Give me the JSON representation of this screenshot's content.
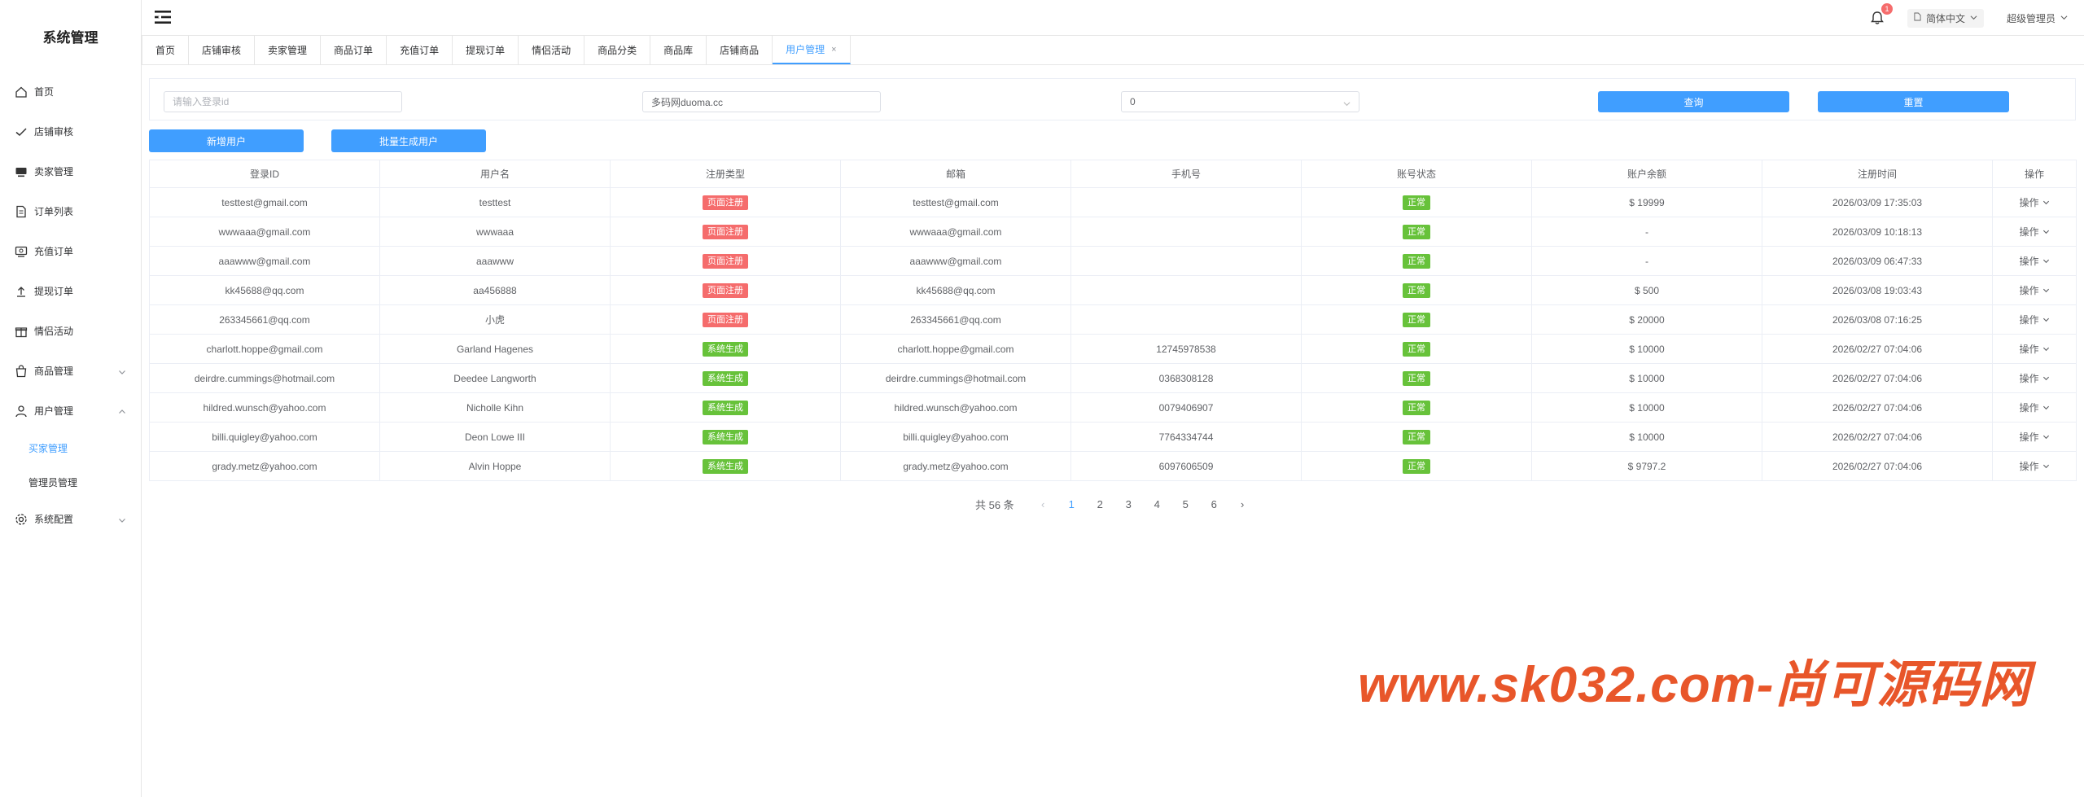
{
  "sidebar": {
    "title": "系统管理",
    "items": [
      {
        "label": "首页",
        "icon": "home-icon"
      },
      {
        "label": "店铺审核",
        "icon": "check-icon"
      },
      {
        "label": "卖家管理",
        "icon": "monitor-icon"
      },
      {
        "label": "订单列表",
        "icon": "document-icon"
      },
      {
        "label": "充值订单",
        "icon": "recharge-icon"
      },
      {
        "label": "提现订单",
        "icon": "upload-icon"
      },
      {
        "label": "情侣活动",
        "icon": "gift-icon"
      },
      {
        "label": "商品管理",
        "icon": "bag-icon"
      },
      {
        "label": "用户管理",
        "icon": "user-icon"
      },
      {
        "label": "系统配置",
        "icon": "gear-icon"
      }
    ],
    "submenu": [
      {
        "label": "买家管理"
      },
      {
        "label": "管理员管理"
      }
    ]
  },
  "header": {
    "notification_count": "1",
    "language": "简体中文",
    "user": "超级管理员"
  },
  "tabs": [
    {
      "label": "首页"
    },
    {
      "label": "店铺审核"
    },
    {
      "label": "卖家管理"
    },
    {
      "label": "商品订单"
    },
    {
      "label": "充值订单"
    },
    {
      "label": "提现订单"
    },
    {
      "label": "情侣活动"
    },
    {
      "label": "商品分类"
    },
    {
      "label": "商品库"
    },
    {
      "label": "店铺商品"
    },
    {
      "label": "用户管理",
      "close": "×"
    }
  ],
  "search": {
    "login_id_placeholder": "请输入登录id",
    "domain_value": "多码网duoma.cc",
    "select_value": "0",
    "query_label": "查询",
    "reset_label": "重置"
  },
  "actions": {
    "add_user_label": "新增用户",
    "batch_generate_label": "批量生成用户"
  },
  "table": {
    "headers": [
      "登录ID",
      "用户名",
      "注册类型",
      "邮箱",
      "手机号",
      "账号状态",
      "账户余额",
      "注册时间",
      "操作"
    ],
    "rows": [
      {
        "login_id": "testtest@gmail.com",
        "username": "testtest",
        "reg_type": "页面注册",
        "email": "testtest@gmail.com",
        "phone": "",
        "status": "正常",
        "balance": "$ 19999",
        "reg_time": "2026/03/09 17:35:03",
        "op": "操作"
      },
      {
        "login_id": "wwwaaa@gmail.com",
        "username": "wwwaaa",
        "reg_type": "页面注册",
        "email": "wwwaaa@gmail.com",
        "phone": "",
        "status": "正常",
        "balance": "-",
        "reg_time": "2026/03/09 10:18:13",
        "op": "操作"
      },
      {
        "login_id": "aaawww@gmail.com",
        "username": "aaawww",
        "reg_type": "页面注册",
        "email": "aaawww@gmail.com",
        "phone": "",
        "status": "正常",
        "balance": "-",
        "reg_time": "2026/03/09 06:47:33",
        "op": "操作"
      },
      {
        "login_id": "kk45688@qq.com",
        "username": "aa456888",
        "reg_type": "页面注册",
        "email": "kk45688@qq.com",
        "phone": "",
        "status": "正常",
        "balance": "$ 500",
        "reg_time": "2026/03/08 19:03:43",
        "op": "操作"
      },
      {
        "login_id": "263345661@qq.com",
        "username": "小虎",
        "reg_type": "页面注册",
        "email": "263345661@qq.com",
        "phone": "",
        "status": "正常",
        "balance": "$ 20000",
        "reg_time": "2026/03/08 07:16:25",
        "op": "操作"
      },
      {
        "login_id": "charlott.hoppe@gmail.com",
        "username": "Garland Hagenes",
        "reg_type": "系统生成",
        "email": "charlott.hoppe@gmail.com",
        "phone": "12745978538",
        "status": "正常",
        "balance": "$ 10000",
        "reg_time": "2026/02/27 07:04:06",
        "op": "操作"
      },
      {
        "login_id": "deirdre.cummings@hotmail.com",
        "username": "Deedee Langworth",
        "reg_type": "系统生成",
        "email": "deirdre.cummings@hotmail.com",
        "phone": "0368308128",
        "status": "正常",
        "balance": "$ 10000",
        "reg_time": "2026/02/27 07:04:06",
        "op": "操作"
      },
      {
        "login_id": "hildred.wunsch@yahoo.com",
        "username": "Nicholle Kihn",
        "reg_type": "系统生成",
        "email": "hildred.wunsch@yahoo.com",
        "phone": "0079406907",
        "status": "正常",
        "balance": "$ 10000",
        "reg_time": "2026/02/27 07:04:06",
        "op": "操作"
      },
      {
        "login_id": "billi.quigley@yahoo.com",
        "username": "Deon Lowe III",
        "reg_type": "系统生成",
        "email": "billi.quigley@yahoo.com",
        "phone": "7764334744",
        "status": "正常",
        "balance": "$ 10000",
        "reg_time": "2026/02/27 07:04:06",
        "op": "操作"
      },
      {
        "login_id": "grady.metz@yahoo.com",
        "username": "Alvin Hoppe",
        "reg_type": "系统生成",
        "email": "grady.metz@yahoo.com",
        "phone": "6097606509",
        "status": "正常",
        "balance": "$ 9797.2",
        "reg_time": "2026/02/27 07:04:06",
        "op": "操作"
      }
    ]
  },
  "pagination": {
    "total_text": "共 56 条",
    "prev": "‹",
    "next": "›",
    "pages": [
      "1",
      "2",
      "3",
      "4",
      "5",
      "6"
    ],
    "current": "1"
  },
  "watermark": "www.sk032.com-尚可源码网",
  "colors": {
    "primary": "#409eff",
    "danger": "#f56c6c",
    "success": "#67c23a",
    "watermark": "#e8562a"
  }
}
